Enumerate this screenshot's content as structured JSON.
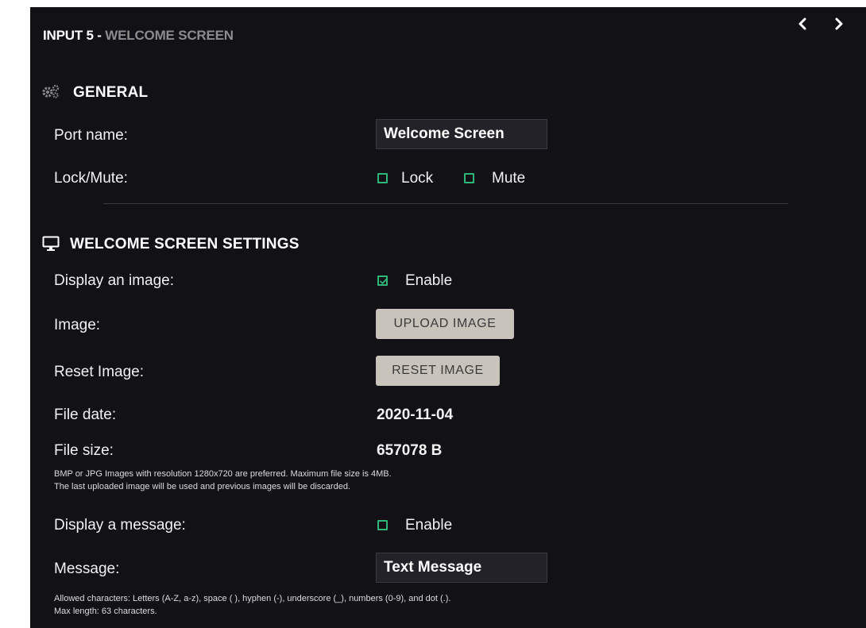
{
  "header": {
    "title_main": "INPUT 5 - ",
    "title_sub": "WELCOME SCREEN",
    "prev_icon": "chevron-left-icon",
    "next_icon": "chevron-right-icon"
  },
  "general": {
    "heading": "GENERAL",
    "icon": "gears-icon",
    "port_name_label": "Port name:",
    "port_name_value": "Welcome Screen",
    "lock_mute_label": "Lock/Mute:",
    "lock_label": "Lock",
    "lock_checked": false,
    "mute_label": "Mute",
    "mute_checked": false
  },
  "welcome": {
    "heading": "WELCOME SCREEN SETTINGS",
    "icon": "monitor-icon",
    "display_image_label": "Display an image:",
    "display_image_enable_label": "Enable",
    "display_image_checked": true,
    "image_label": "Image:",
    "upload_button": "UPLOAD IMAGE",
    "reset_label": "Reset Image:",
    "reset_button": "RESET IMAGE",
    "file_date_label": "File date:",
    "file_date_value": "2020-11-04",
    "file_size_label": "File size:",
    "file_size_value": "657078 B",
    "image_note_1": "BMP or JPG Images with resolution 1280x720 are preferred. Maximum file size is 4MB.",
    "image_note_2": "The last uploaded image will be used and previous images will be discarded.",
    "display_message_label": "Display a message:",
    "display_message_enable_label": "Enable",
    "display_message_checked": false,
    "message_label": "Message:",
    "message_value": "Text Message",
    "message_note_1": "Allowed characters: Letters (A-Z, a-z), space ( ), hyphen (-), underscore (_), numbers (0-9), and dot (.).",
    "message_note_2": "Max length: 63 characters."
  },
  "colors": {
    "panel_bg": "#111116",
    "accent_checkbox": "#2db57a",
    "button_bg": "#c8c4bc",
    "subtitle_gray": "#8c8c8c"
  }
}
